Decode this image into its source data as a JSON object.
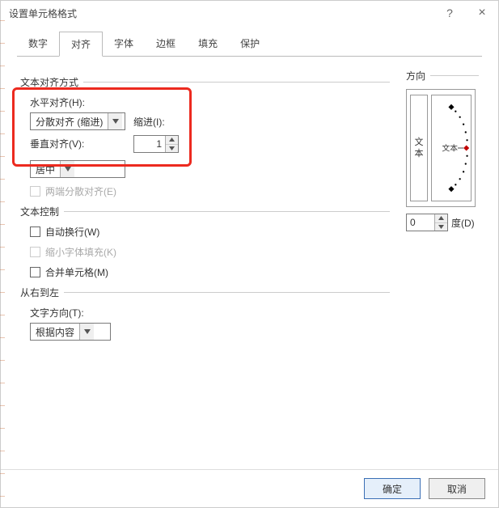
{
  "titlebar": {
    "title": "设置单元格格式",
    "help_label": "?",
    "close_label": "×"
  },
  "tabs": [
    "数字",
    "对齐",
    "字体",
    "边框",
    "填充",
    "保护"
  ],
  "active_tab_index": 1,
  "alignment": {
    "group_title": "文本对齐方式",
    "horizontal_label": "水平对齐(H):",
    "horizontal_value": "分散对齐 (缩进)",
    "indent_label": "缩进(I):",
    "indent_value": "1",
    "vertical_label": "垂直对齐(V):",
    "vertical_value": "居中",
    "justify_distributed_label": "两端分散对齐(E)"
  },
  "text_control": {
    "group_title": "文本控制",
    "wrap_label": "自动换行(W)",
    "shrink_label": "缩小字体填充(K)",
    "merge_label": "合并单元格(M)"
  },
  "rtl": {
    "group_title": "从右到左",
    "direction_label": "文字方向(T):",
    "direction_value": "根据内容"
  },
  "orientation": {
    "group_title": "方向",
    "vertical_text": "文本",
    "arc_text": "文本",
    "degrees_value": "0",
    "degrees_label": "度(D)"
  },
  "buttons": {
    "ok": "确定",
    "cancel": "取消"
  }
}
